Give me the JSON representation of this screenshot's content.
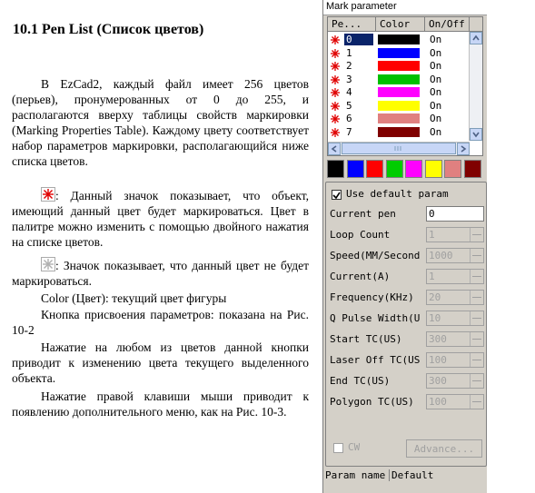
{
  "document": {
    "heading": "10.1 Pen List (Список цветов)",
    "para1": "В EzCad2, каждый файл имеет 256 цветов (перьев), пронумерованных от 0 до 255, и располагаются вверху таблицы свойств маркировки (Marking Properties Table). Каждому цвету соответствует набор параметров маркировки, располагающийся ниже списка цветов.",
    "para2": ": Данный значок показывает, что объект, имеющий данный цвет будет маркироваться. Цвет в палитре можно изменить с помощью двойного нажатия на списке цветов.",
    "para3": ": Значок показывает, что данный цвет не будет маркироваться.",
    "para4": "Color (Цвет): текущий цвет фигуры",
    "para5": "Кнопка присвоения параметров: показана на Рис. 10-2",
    "para6": "Нажатие на любом из цветов данной кнопки приводит к изменению цвета текущего выделенного объекта.",
    "para7": "Нажатие правой клавиши мыши приводит к появлению дополнительного меню, как на Рис. 10-3.",
    "icon_marked": "red-star-icon",
    "icon_unmarked": "gray-star-icon"
  },
  "panel": {
    "title": "Mark parameter",
    "columns": [
      "Pe...",
      "Color",
      "On/Off"
    ],
    "pens": [
      {
        "num": "0",
        "color": "#000000",
        "state": "On"
      },
      {
        "num": "1",
        "color": "#0000ff",
        "state": "On"
      },
      {
        "num": "2",
        "color": "#ff0000",
        "state": "On"
      },
      {
        "num": "3",
        "color": "#00c000",
        "state": "On"
      },
      {
        "num": "4",
        "color": "#ff00ff",
        "state": "On"
      },
      {
        "num": "5",
        "color": "#ffff00",
        "state": "On"
      },
      {
        "num": "6",
        "color": "#e08080",
        "state": "On"
      },
      {
        "num": "7",
        "color": "#800000",
        "state": "On"
      }
    ],
    "palette": [
      "#000000",
      "#0000ff",
      "#ff0000",
      "#00cc00",
      "#ff00ff",
      "#ffff00",
      "#e08080",
      "#800000"
    ],
    "use_default": "Use default param",
    "fields": [
      {
        "label": "Current pen",
        "value": "0",
        "disabled": false,
        "spin": false
      },
      {
        "label": "Loop Count",
        "value": "1",
        "disabled": true,
        "spin": true
      },
      {
        "label": "Speed(MM/Second",
        "value": "1000",
        "disabled": true,
        "spin": true
      },
      {
        "label": "Current(A)",
        "value": "1",
        "disabled": true,
        "spin": true
      },
      {
        "label": "Frequency(KHz)",
        "value": "20",
        "disabled": true,
        "spin": true
      },
      {
        "label": "Q Pulse Width(U",
        "value": "10",
        "disabled": true,
        "spin": true
      },
      {
        "label": "Start TC(US)",
        "value": "300",
        "disabled": true,
        "spin": true
      },
      {
        "label": "Laser Off TC(US",
        "value": "100",
        "disabled": true,
        "spin": true
      },
      {
        "label": "End TC(US)",
        "value": "300",
        "disabled": true,
        "spin": true
      },
      {
        "label": "Polygon TC(US)",
        "value": "100",
        "disabled": true,
        "spin": true
      }
    ],
    "cw_label": "CW",
    "advance_label": "Advance...",
    "param_name_label": "Param name",
    "param_name_value": "Default"
  }
}
